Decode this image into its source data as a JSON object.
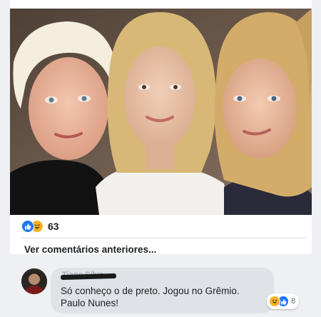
{
  "post": {
    "reactions": {
      "types": [
        "like-icon",
        "haha-icon"
      ],
      "count": "63"
    },
    "view_previous_comments": "Ver comentários anteriores..."
  },
  "comment": {
    "author": "Tiago Silva",
    "text_line1": "Só conheço o de preto. Jogou no Grêmio.",
    "text_line2": "Paulo Nunes!",
    "reactions": {
      "types": [
        "haha-icon",
        "like-icon"
      ],
      "count": "8"
    }
  },
  "colors": {
    "like": "#1877f2",
    "haha": "#f7b125",
    "bubble": "#dfe3e8",
    "background": "#eef0f3"
  }
}
